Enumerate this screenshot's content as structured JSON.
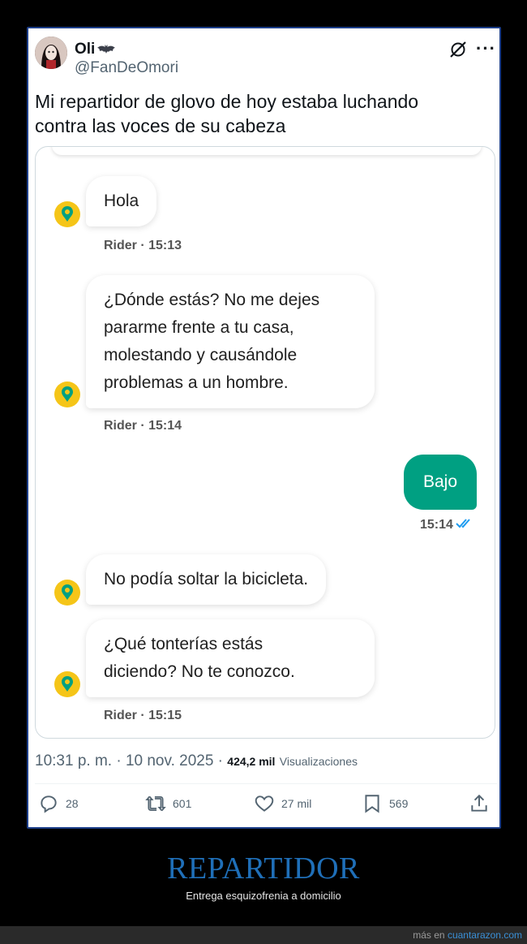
{
  "tweet": {
    "display_name": "Oli",
    "handle": "@FanDeOmori",
    "text_line1": "Mi repartidor de glovo de hoy estaba luchando",
    "text_line2": "contra las voces de su cabeza",
    "datetime": "10:31 p. m. · 10 nov. 2025",
    "separator": " · ",
    "views_count": "424,2 mil",
    "views_label": "Visualizaciones",
    "icons": {
      "more": "more-icon",
      "grok": "grok-icon",
      "badge": "bat-icon"
    }
  },
  "chat": {
    "messages": [
      {
        "from": "rider",
        "lines": [
          "Hola"
        ]
      },
      {
        "from": "rider",
        "lines": [
          "¿Dónde estás? No me dejes",
          "pararme frente a tu casa,",
          "molestando y causándole",
          "problemas a un hombre."
        ]
      },
      {
        "from": "me",
        "lines": [
          "Bajo"
        ]
      },
      {
        "from": "rider",
        "lines": [
          "No podía soltar la bicicleta."
        ]
      },
      {
        "from": "rider",
        "lines": [
          "¿Qué tonterías estás",
          "diciendo? No te conozco."
        ]
      }
    ],
    "meta1": "Rider · 15:13",
    "meta2": "Rider · 15:14",
    "meta3": "15:14",
    "meta4": "Rider · 15:15",
    "brand_color": "#00a082",
    "rider_icon_color": "#f5c518"
  },
  "actions": {
    "reply_count": "28",
    "retweet_count": "601",
    "like_count": "27 mil",
    "bookmark_count": "569"
  },
  "caption": {
    "title": "REPARTIDOR",
    "subtitle": "Entrega esquizofrenia a domicilio"
  },
  "footer": {
    "prefix": "más en ",
    "site": "cuantarazon.com"
  },
  "colors": {
    "caption_title": "#1f6fb8",
    "card_border": "#1d3f8a",
    "read_ticks": "#1d9bf0"
  }
}
